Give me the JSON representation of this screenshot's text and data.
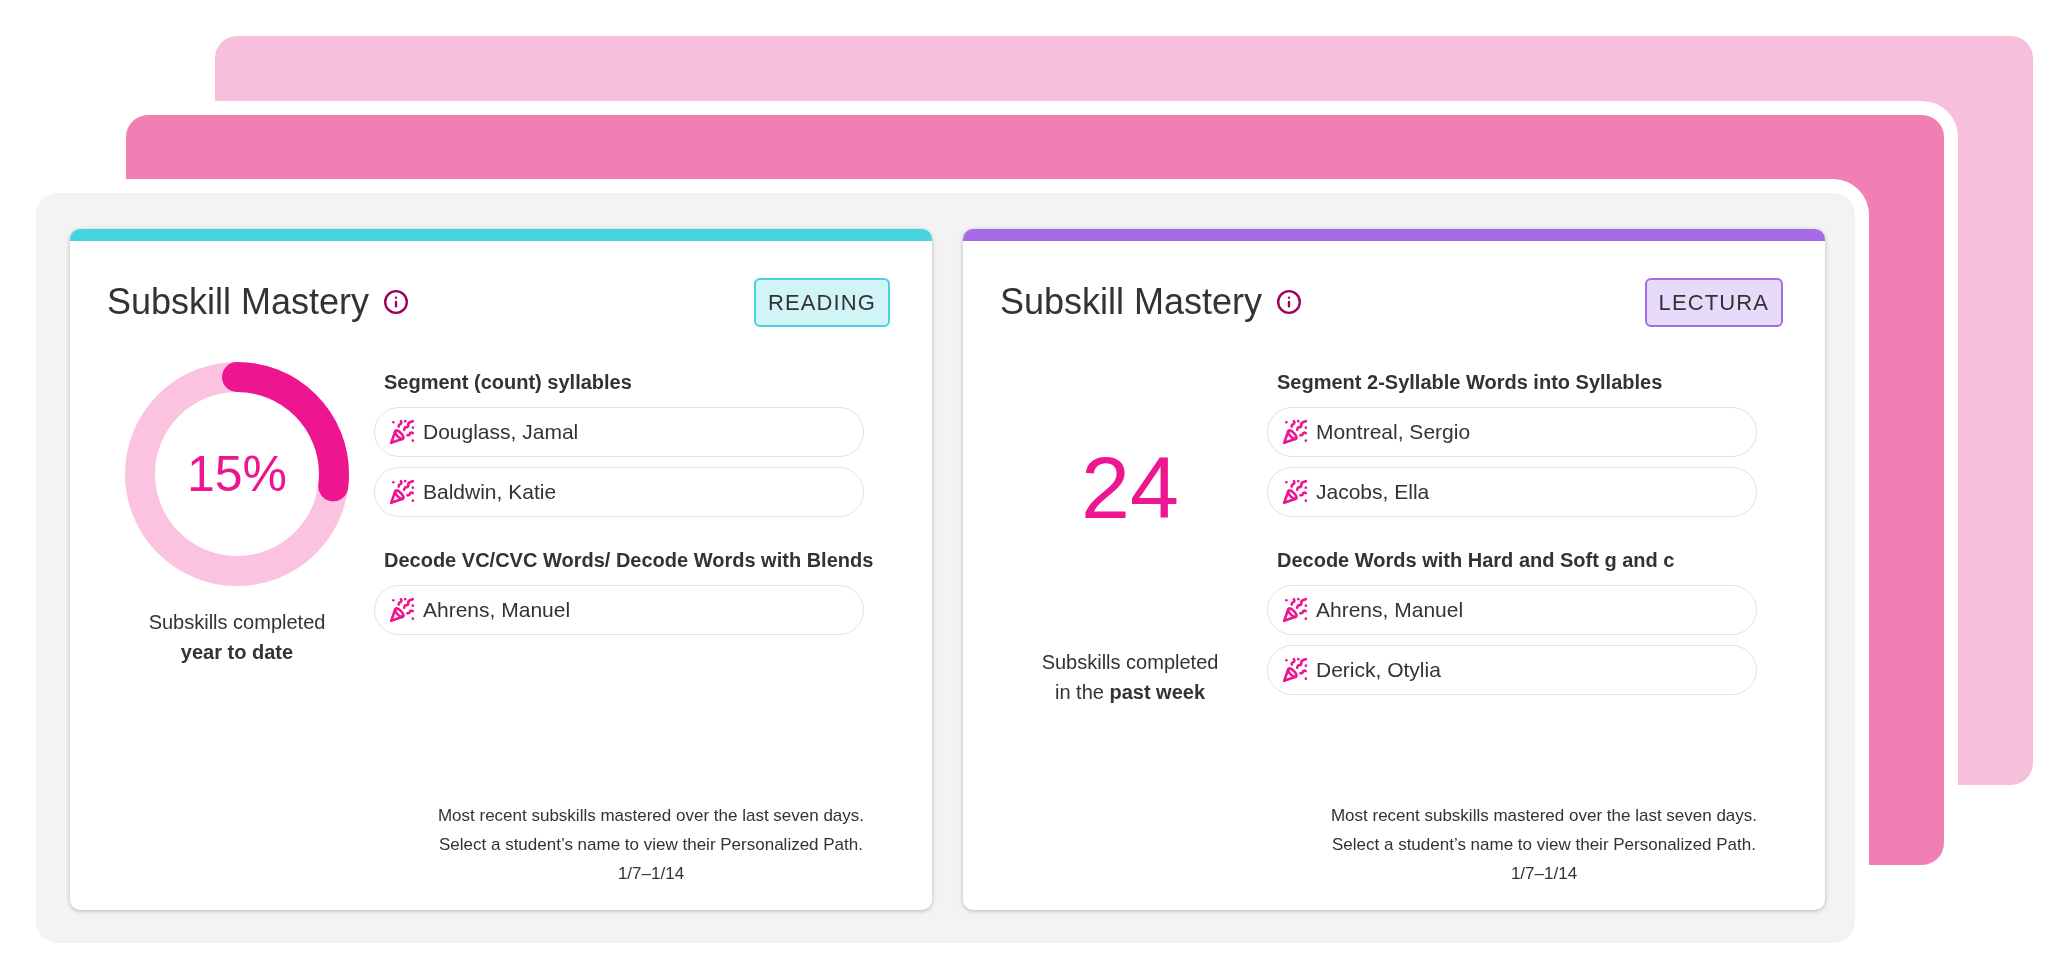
{
  "cards": [
    {
      "title": "Subskill Mastery",
      "subject": "READING",
      "color": "#46d3de",
      "stat": {
        "kind": "donut",
        "value": "15%",
        "caption": "Subskills completed **year to date**"
      },
      "skills": [
        {
          "name": "Segment (count) syllables",
          "students": [
            "Douglass, Jamal",
            "Baldwin, Katie"
          ]
        },
        {
          "name": "Decode VC/CVC Words/ Decode Words with Blends",
          "students": [
            "Ahrens, Manuel"
          ]
        }
      ],
      "footer": [
        "Most recent subskills mastered over the last seven days.",
        "Select a student’s name to view their Personalized Path."
      ],
      "date": "1/7–1/14"
    },
    {
      "title": "Subskill Mastery",
      "subject": "LECTURA",
      "color": "#a56ae6",
      "stat": {
        "kind": "count",
        "value": "24",
        "caption": "Subskills completed in the **past week**"
      },
      "skills": [
        {
          "name": "Segment 2-Syllable Words into Syllables",
          "students": [
            "Montreal, Sergio",
            "Jacobs, Ella"
          ]
        },
        {
          "name": "Decode Words with Hard and Soft g and c",
          "students": [
            "Ahrens, Manuel",
            "Derick, Otylia"
          ]
        }
      ],
      "footer": [
        "Most recent subskills mastered over the last seven days.",
        "Select a student’s name to view their Personalized Path."
      ],
      "date": "1/7–1/14"
    }
  ]
}
